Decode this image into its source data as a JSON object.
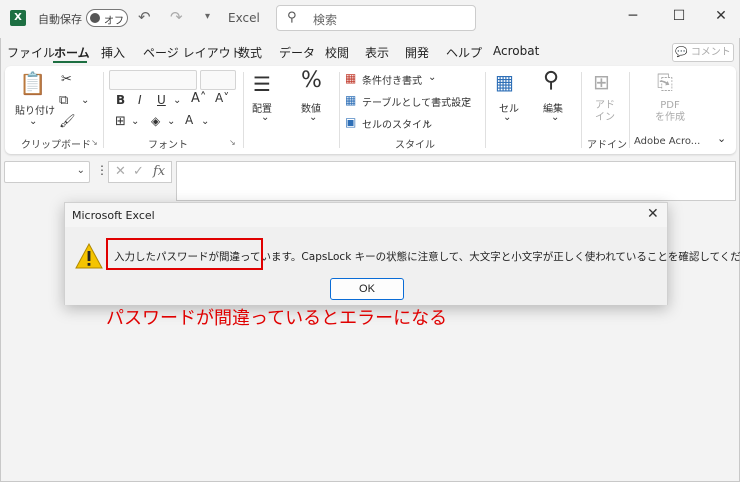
{
  "titlebar": {
    "autosave_label": "自動保存",
    "toggle_state": "オフ",
    "doc_title": "Excel",
    "search_placeholder": "検索"
  },
  "menu": {
    "items": [
      "ファイル",
      "ホーム",
      "挿入",
      "ページ レイアウト",
      "数式",
      "データ",
      "校閲",
      "表示",
      "開発",
      "ヘルプ",
      "Acrobat"
    ],
    "active": "ホーム",
    "comment_button": "コメント"
  },
  "ribbon": {
    "paste_label": "貼り付け",
    "groups": {
      "clipboard": "クリップボード",
      "font": "フォント",
      "styles": "スタイル",
      "addins": "アドイン",
      "adobe": "Adobe Acro..."
    },
    "alignment": "配置",
    "number": "数値",
    "conditional_format": "条件付き書式",
    "format_as_table": "テーブルとして書式設定",
    "cell_styles": "セルのスタイル",
    "cells": "セル",
    "editing": "編集",
    "addins_btn": "アド\nイン",
    "pdf_btn": "PDF\nを作成"
  },
  "formula_bar": {
    "fx": "fx"
  },
  "dialog": {
    "title": "Microsoft Excel",
    "message": "入力したパスワードが間違っています。CapsLock キーの状態に注意して、大文字と小文字が正しく使われていることを確認してください。",
    "ok_label": "OK"
  },
  "annotation": {
    "text": "パスワードが間違っているとエラーになる",
    "color": "#e00000"
  },
  "colors": {
    "excel_green": "#1d6f42",
    "highlight_red": "#e00000"
  }
}
